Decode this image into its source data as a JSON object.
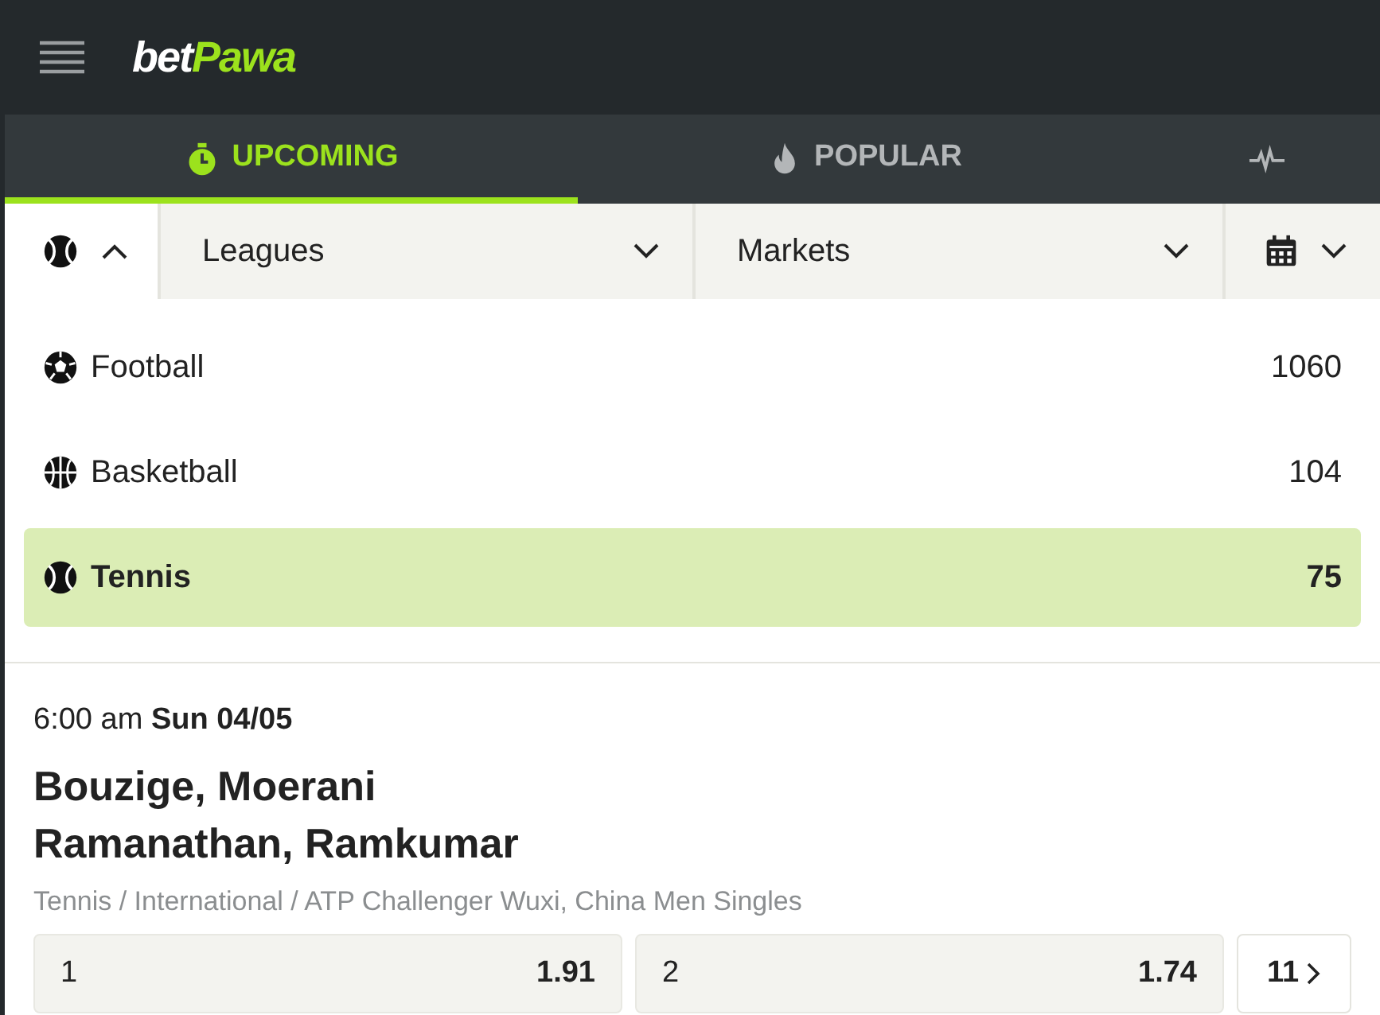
{
  "header": {
    "logo": {
      "part_1": "bet",
      "part_2": "Pawa"
    }
  },
  "tabs": [
    {
      "kind": "stopwatch",
      "label": "UPCOMING",
      "selected": true
    },
    {
      "kind": "flame",
      "label": "POPULAR",
      "selected": false
    },
    {
      "kind": "pulse",
      "selected": false
    }
  ],
  "filters": {
    "sport": {
      "expanded": true
    },
    "leagues": {
      "label": "Leagues"
    },
    "markets": {
      "label": "Markets"
    }
  },
  "sports": [
    {
      "kind": "football",
      "name": "Football",
      "count": "1060",
      "selected": false
    },
    {
      "kind": "basketball",
      "name": "Basketball",
      "count": "104",
      "selected": false
    },
    {
      "kind": "tennis",
      "name": "Tennis",
      "count": "75",
      "selected": true
    }
  ],
  "event": {
    "datetime": "6:00 am **Sun 04/05**",
    "teams": [
      "Bouzige, Moerani",
      "Ramanathan, Ramkumar"
    ],
    "breadcrumb": "Tennis / International / ATP Challenger Wuxi, China Men Singles",
    "odds": [
      {
        "label": "1",
        "value": "1.91"
      },
      {
        "label": "2",
        "value": "1.74"
      }
    ],
    "more_markets": "11"
  }
}
